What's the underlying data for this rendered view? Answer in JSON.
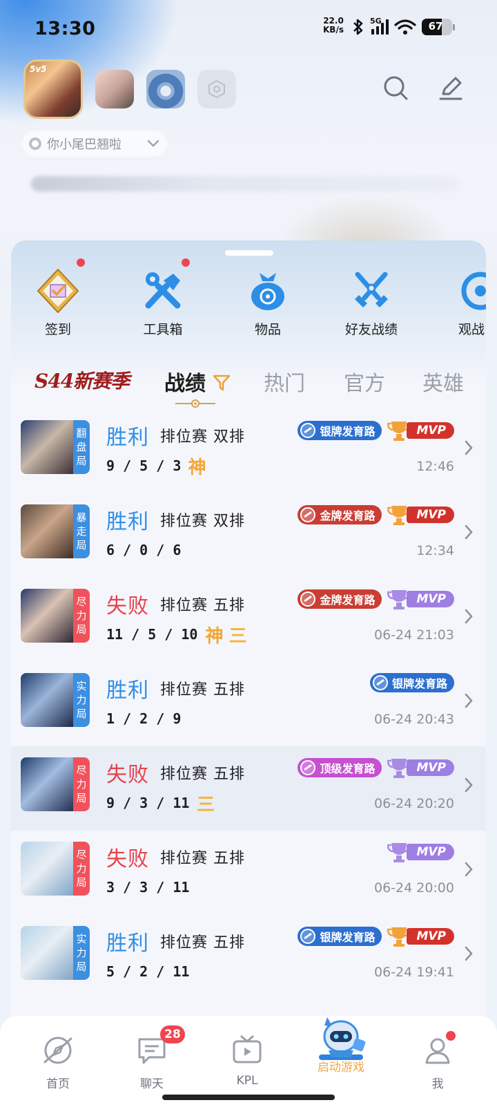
{
  "status_bar": {
    "time": "13:30",
    "net_speed_value": "22.0",
    "net_speed_unit": "KB/s",
    "network_type": "5G",
    "battery": "67"
  },
  "header": {
    "main_game_tag": "5v5",
    "account_name": "你小尾巴翘啦"
  },
  "quick_actions": [
    {
      "label": "签到",
      "icon": "checkin-icon",
      "dot": true
    },
    {
      "label": "工具箱",
      "icon": "toolbox-icon",
      "dot": true
    },
    {
      "label": "物品",
      "icon": "bag-icon",
      "dot": false
    },
    {
      "label": "好友战绩",
      "icon": "crossed-swords-icon",
      "dot": false
    },
    {
      "label": "观战",
      "icon": "watch-icon",
      "dot": false
    }
  ],
  "tabs": {
    "season": "S44新赛季",
    "items": [
      "战绩",
      "热门",
      "官方",
      "英雄"
    ],
    "active": "战绩"
  },
  "records": [
    {
      "mode": "翻盘局",
      "mode_color": "#3d8fe0",
      "result": "胜利",
      "type": "排位赛 双排",
      "kda": "9 / 5 / 3",
      "shen": "神",
      "san": "",
      "position_badge": "银牌发育路",
      "badge_kind": "silver",
      "mvp": "MVP",
      "mvp_kind": "gold",
      "time": "12:46"
    },
    {
      "mode": "暴走局",
      "mode_color": "#3d8fe0",
      "result": "胜利",
      "type": "排位赛 双排",
      "kda": "6 / 0 / 6",
      "shen": "",
      "san": "",
      "position_badge": "金牌发育路",
      "badge_kind": "gold",
      "mvp": "MVP",
      "mvp_kind": "gold",
      "time": "12:34"
    },
    {
      "mode": "尽力局",
      "mode_color": "#f0525c",
      "result": "失败",
      "type": "排位赛 五排",
      "kda": "11 / 5 / 10",
      "shen": "神",
      "san": "三",
      "position_badge": "金牌发育路",
      "badge_kind": "gold",
      "mvp": "MVP",
      "mvp_kind": "purple",
      "time": "06-24 21:03"
    },
    {
      "mode": "实力局",
      "mode_color": "#3d8fe0",
      "result": "胜利",
      "type": "排位赛 五排",
      "kda": "1 / 2 / 9",
      "shen": "",
      "san": "",
      "position_badge": "银牌发育路",
      "badge_kind": "silver",
      "mvp": "",
      "mvp_kind": "",
      "time": "06-24 20:43"
    },
    {
      "mode": "尽力局",
      "mode_color": "#f0525c",
      "result": "失败",
      "type": "排位赛 五排",
      "kda": "9 / 3 / 11",
      "shen": "",
      "san": "三",
      "position_badge": "顶级发育路",
      "badge_kind": "top",
      "mvp": "MVP",
      "mvp_kind": "purple",
      "time": "06-24 20:20"
    },
    {
      "mode": "尽力局",
      "mode_color": "#f0525c",
      "result": "失败",
      "type": "排位赛 五排",
      "kda": "3 / 3 / 11",
      "shen": "",
      "san": "",
      "position_badge": "",
      "badge_kind": "",
      "mvp": "MVP",
      "mvp_kind": "purple",
      "time": "06-24 20:00"
    },
    {
      "mode": "实力局",
      "mode_color": "#3d8fe0",
      "result": "胜利",
      "type": "排位赛 五排",
      "kda": "5 / 2 / 11",
      "shen": "",
      "san": "",
      "position_badge": "银牌发育路",
      "badge_kind": "silver",
      "mvp": "MVP",
      "mvp_kind": "gold",
      "time": "06-24 19:41"
    }
  ],
  "bottom_nav": [
    {
      "label": "首页",
      "icon": "compass-icon",
      "badge": ""
    },
    {
      "label": "聊天",
      "icon": "chat-icon",
      "badge": "28"
    },
    {
      "label": "KPL",
      "icon": "tv-icon",
      "badge": ""
    },
    {
      "label": "启动游戏",
      "icon": "robot-mascot-icon",
      "badge": "",
      "active": true
    },
    {
      "label": "我",
      "icon": "person-icon",
      "badge": "",
      "dot": true
    }
  ],
  "colors": {
    "win": "#2f8ee8",
    "lose": "#e8424c",
    "accent": "#f2a640",
    "badge_red": "#f0444e"
  }
}
